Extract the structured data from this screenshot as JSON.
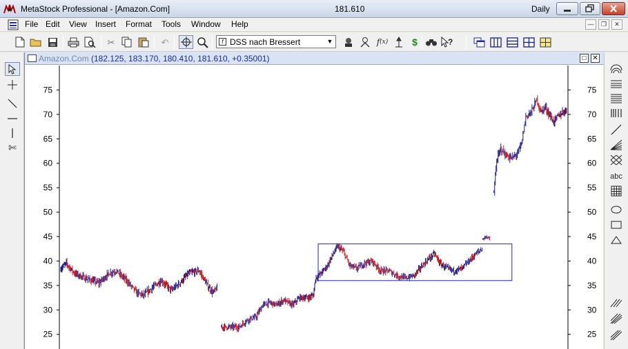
{
  "titlebar": {
    "title": "MetaStock Professional - [Amazon.Com]",
    "last_price": "181.610",
    "periodicity": "Daily"
  },
  "menu": [
    "File",
    "Edit",
    "View",
    "Insert",
    "Format",
    "Tools",
    "Window",
    "Help"
  ],
  "toolbar": {
    "indicator_selected": "DSS nach Bressert"
  },
  "chart_window": {
    "title": "Amazon.Com",
    "ohlc": "(182.125, 183.170, 180.410, 181.610, +0.35001)"
  },
  "colors": {
    "up_bar": "#1a1a8c",
    "down_bar": "#cc1f1f",
    "box": "#1e22c8"
  },
  "chart_data": {
    "type": "ohlc",
    "title": "Amazon.Com",
    "ylim": [
      22,
      80
    ],
    "y_ticks": [
      "25",
      "30",
      "35",
      "40",
      "45",
      "50",
      "55",
      "60",
      "65",
      "70",
      "75"
    ],
    "segments": [
      {
        "anchors": [
          [
            0,
            38.5
          ],
          [
            8,
            39.5
          ],
          [
            20,
            37.5
          ],
          [
            35,
            36.5
          ],
          [
            55,
            35.5
          ],
          [
            70,
            37.5
          ],
          [
            80,
            38.0
          ],
          [
            95,
            36.0
          ],
          [
            110,
            33.5
          ],
          [
            120,
            33.0
          ],
          [
            132,
            34.5
          ],
          [
            145,
            36.0
          ],
          [
            160,
            34.0
          ],
          [
            172,
            35.5
          ],
          [
            185,
            37.5
          ],
          [
            200,
            38.0
          ],
          [
            212,
            35.0
          ],
          [
            220,
            33.5
          ],
          [
            226,
            34.5
          ]
        ],
        "noise": 0.9
      },
      {
        "anchors": [
          [
            232,
            26.5
          ],
          [
            245,
            26.5
          ],
          [
            258,
            26.5
          ],
          [
            270,
            28.0
          ],
          [
            282,
            28.5
          ],
          [
            292,
            31.0
          ],
          [
            302,
            31.5
          ],
          [
            312,
            31.0
          ],
          [
            322,
            32.0
          ],
          [
            335,
            31.0
          ],
          [
            345,
            32.5
          ],
          [
            358,
            32.5
          ],
          [
            365,
            33.0
          ],
          [
            368,
            36.5
          ],
          [
            376,
            37.5
          ],
          [
            385,
            39.0
          ],
          [
            392,
            41.0
          ],
          [
            400,
            43.0
          ],
          [
            408,
            42.0
          ],
          [
            418,
            39.0
          ],
          [
            428,
            38.5
          ],
          [
            438,
            39.5
          ],
          [
            450,
            40.0
          ],
          [
            462,
            38.0
          ],
          [
            474,
            38.0
          ],
          [
            486,
            37.0
          ],
          [
            498,
            36.5
          ],
          [
            510,
            37.0
          ],
          [
            522,
            39.0
          ],
          [
            532,
            40.5
          ],
          [
            540,
            41.5
          ],
          [
            548,
            39.5
          ],
          [
            558,
            38.5
          ],
          [
            568,
            38.0
          ],
          [
            580,
            38.5
          ],
          [
            590,
            40.0
          ],
          [
            600,
            41.5
          ],
          [
            609,
            42.5
          ]
        ],
        "noise": 0.8
      },
      {
        "anchors": [
          [
            610,
            44.5
          ],
          [
            615,
            45.0
          ],
          [
            620,
            44.5
          ]
        ],
        "noise": 0.4
      },
      {
        "anchors": [
          [
            626,
            54.0
          ],
          [
            630,
            60.5
          ],
          [
            636,
            63.0
          ],
          [
            644,
            61.5
          ],
          [
            652,
            61.0
          ],
          [
            660,
            62.0
          ],
          [
            666,
            64.0
          ],
          [
            672,
            69.5
          ],
          [
            680,
            70.5
          ],
          [
            688,
            73.0
          ],
          [
            694,
            70.5
          ],
          [
            700,
            71.5
          ],
          [
            706,
            70.0
          ],
          [
            712,
            68.5
          ],
          [
            718,
            69.5
          ],
          [
            726,
            70.5
          ],
          [
            731,
            71.0
          ]
        ],
        "noise": 1.0
      }
    ],
    "annotation_box": {
      "x": [
        372,
        652
      ],
      "y": [
        36.0,
        43.5
      ]
    }
  }
}
